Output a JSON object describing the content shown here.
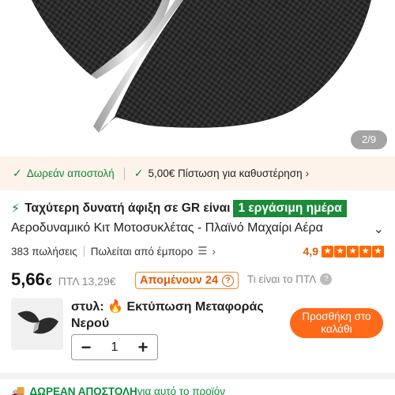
{
  "gallery": {
    "counter": "2/9"
  },
  "benefits": {
    "free_shipping": "Δωρεάν αποστολή",
    "credit": "5,00€ Πίστωση για καθυστέρηση",
    "chevron": "›"
  },
  "fast": {
    "icon": "lightning-bolt-icon",
    "text": "Ταχύτερη δυνατή άφιξη σε GR είναι",
    "badge": "1 εργάσιμη ημέρα"
  },
  "product": {
    "title": "Αεροδυναμικό Κιτ Μοτοσυκλέτας - Πλαϊνό Μαχαίρι Αέρα",
    "more_icon": "chevron-down-icon"
  },
  "sales": {
    "count": "383 πωλήσεις",
    "seller": "Πωλείται από έμπορο",
    "rating": "4,9",
    "stars": 5
  },
  "price": {
    "current_main": "5,66",
    "currency": "€",
    "old": "ΠΤΛ 13,29€",
    "remaining": "Απομένουν 24",
    "what_is": "Τι είναι το ΠΤΛ"
  },
  "style": {
    "label": "στυλ:",
    "value": "Εκτύπωση Μεταφοράς Νερού"
  },
  "quantity": {
    "minus": "−",
    "value": "1",
    "plus": "+"
  },
  "cart": {
    "add_label": "Προσθήκη στο καλάθι"
  },
  "free_banner": {
    "strong": "ΔΩΡΕΑΝ ΑΠΟΣΤΟΛΗ",
    "rest": "για αυτό το προϊόν"
  },
  "colors": {
    "green": "#0a8a3a",
    "orange": "#ff6a1a"
  }
}
